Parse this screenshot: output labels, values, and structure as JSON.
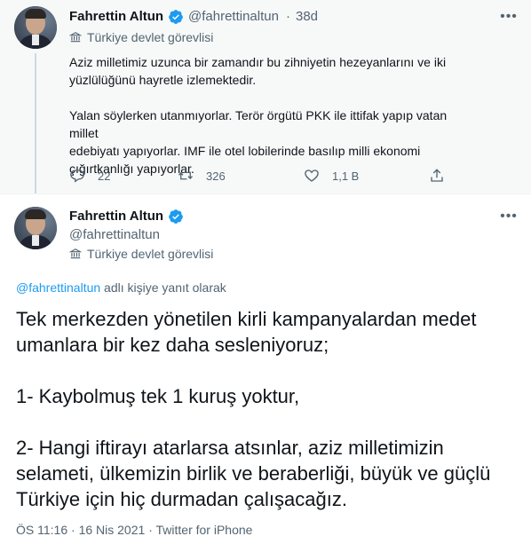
{
  "parent_tweet": {
    "author_name": "Fahrettin Altun",
    "handle": "@fahrettinaltun",
    "separator": "·",
    "time_ago": "38d",
    "label": "Türkiye devlet görevlisi",
    "paragraph1": [
      "Aziz milletimiz uzunca bir zamandır bu zihniyetin hezeyanlarını ve iki",
      "yüzlülüğünü hayretle izlemektedir."
    ],
    "paragraph2": [
      "Yalan söylerken utanmıyorlar. Terör örgütü PKK ile ittifak yapıp vatan millet",
      "edebiyatı yapıyorlar. IMF ile otel lobilerinde basılıp milli ekonomi",
      "çığırtkanlığı yapıyorlar."
    ],
    "reply_count": "22",
    "retweet_count": "326",
    "like_count": "1,1 B"
  },
  "main_tweet": {
    "author_name": "Fahrettin Altun",
    "handle": "@fahrettinaltun",
    "label": "Türkiye devlet görevlisi",
    "replying_to_handle": "@fahrettinaltun",
    "replying_suffix": " adlı kişiye yanıt olarak",
    "lines": [
      "Tek merkezden yönetilen kirli kampanyalardan medet",
      "umanlara bir kez daha sesleniyoruz;",
      "",
      "1- Kaybolmuş tek 1 kuruş yoktur,",
      "",
      "2- Hangi iftirayı atarlarsa atsınlar, aziz milletimizin",
      "selameti, ülkemizin birlik ve beraberliği, büyük ve güçlü",
      "Türkiye için hiç durmadan çalışacağız."
    ],
    "time": "ÖS 11:16",
    "date": "16 Nis 2021",
    "source": "Twitter for iPhone",
    "meta_separator": "·"
  },
  "colors": {
    "verified_blue": "#1d9bf0",
    "secondary_text": "#536471",
    "parent_bg": "#f7f9f9"
  }
}
